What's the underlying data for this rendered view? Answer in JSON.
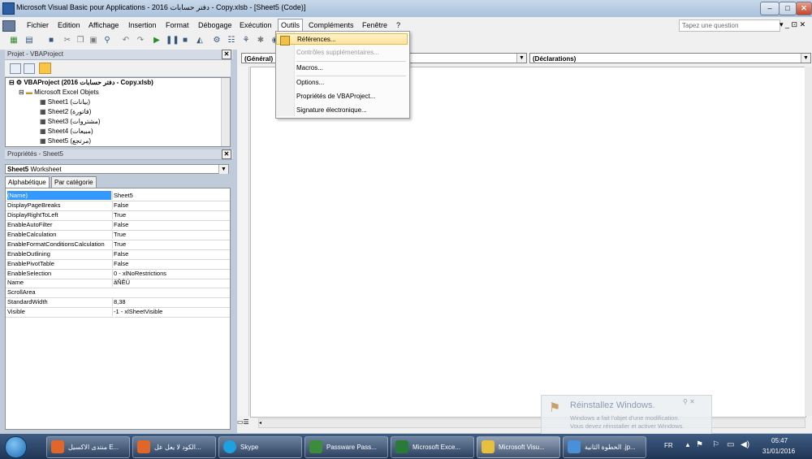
{
  "window": {
    "title": "Microsoft Visual Basic pour Applications - 2016 دفتر حسابات - Copy.xlsb - [Sheet5 (Code)]",
    "min": "–",
    "max": "□",
    "close": "✕"
  },
  "menubar": {
    "items": [
      "Fichier",
      "Edition",
      "Affichage",
      "Insertion",
      "Format",
      "Débogage",
      "Exécution",
      "Outils",
      "Compléments",
      "Fenêtre",
      "?"
    ],
    "ask_placeholder": "Tapez une question",
    "right_controls": "▾ _ ⊡ ✕"
  },
  "outils_menu": {
    "items": [
      {
        "label": "Références...",
        "state": "highlighted"
      },
      {
        "label": "Contrôles supplémentaires...",
        "state": "disabled"
      },
      {
        "label": "Macros..."
      },
      {
        "label": "Options..."
      },
      {
        "label": "Propriétés de VBAProject..."
      },
      {
        "label": "Signature électronique..."
      }
    ]
  },
  "project_pane": {
    "title": "Projet - VBAProject",
    "root": "VBAProject (2016 دفتر حسابات - Copy.xlsb)",
    "folder": "Microsoft Excel Objets",
    "sheets": [
      "Sheet1 (بيانات)",
      "Sheet2 (فاتورة)",
      "Sheet3 (مشتروات)",
      "Sheet4 (مبيعات)",
      "Sheet5 (مرتجع)"
    ]
  },
  "properties_pane": {
    "title": "Propriétés - Sheet5",
    "object_name": "Sheet5",
    "object_type": "Worksheet",
    "tabs": [
      "Alphabétique",
      "Par catégorie"
    ],
    "rows": [
      {
        "name": "(Name)",
        "value": "Sheet5"
      },
      {
        "name": "DisplayPageBreaks",
        "value": "False"
      },
      {
        "name": "DisplayRightToLeft",
        "value": "True"
      },
      {
        "name": "EnableAutoFilter",
        "value": "False"
      },
      {
        "name": "EnableCalculation",
        "value": "True"
      },
      {
        "name": "EnableFormatConditionsCalculation",
        "value": "True"
      },
      {
        "name": "EnableOutlining",
        "value": "False"
      },
      {
        "name": "EnablePivotTable",
        "value": "False"
      },
      {
        "name": "EnableSelection",
        "value": "0 - xlNoRestrictions"
      },
      {
        "name": "Name",
        "value": "ãÑÊÚ"
      },
      {
        "name": "ScrollArea",
        "value": ""
      },
      {
        "name": "StandardWidth",
        "value": "8,38"
      },
      {
        "name": "Visible",
        "value": "-1 - xlSheetVisible"
      }
    ]
  },
  "code_window": {
    "object_combo": "(Général)",
    "proc_combo": "(Déclarations)"
  },
  "activation": {
    "title": "Réinstallez Windows.",
    "line1": "Windows a fait l'objet d'une modification.",
    "line2": "Vous devez réinstaller et activer Windows."
  },
  "taskbar": {
    "items": [
      {
        "label": "منتدى الاكسيل E...",
        "color": "#e0662a"
      },
      {
        "label": "الكود لا يعل عل...",
        "color": "#e0662a"
      },
      {
        "label": "Skype",
        "color": "#1da1e0"
      },
      {
        "label": "Passware Pass...",
        "color": "#3d8b3d"
      },
      {
        "label": "Microsoft Exce...",
        "color": "#2a7a3a"
      },
      {
        "label": "Microsoft Visu...",
        "color": "#e8c040"
      },
      {
        "label": "الخطوة الثانية .jp...",
        "color": "#4a90d9"
      }
    ],
    "lang": "FR",
    "time": "05:47",
    "date": "31/01/2016"
  }
}
